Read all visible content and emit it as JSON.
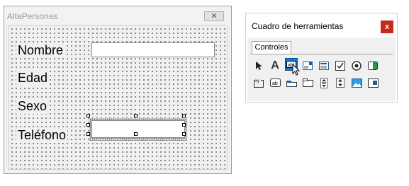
{
  "form": {
    "title": "AltaPersonas",
    "close_glyph": "✕",
    "labels": {
      "nombre": "Nombre",
      "edad": "Edad",
      "sexo": "Sexo",
      "telefono": "Teléfono"
    }
  },
  "toolbox": {
    "title": "Cuadro de herramientas",
    "close_glyph": "x",
    "tab": "Controles",
    "tools_row1": [
      {
        "icon": "select-objects-icon",
        "glyph": "➚"
      },
      {
        "icon": "label-icon",
        "glyph": "A"
      },
      {
        "icon": "textbox-icon",
        "glyph": "ab|"
      },
      {
        "icon": "combobox-icon",
        "glyph": ""
      },
      {
        "icon": "listbox-icon",
        "glyph": ""
      },
      {
        "icon": "checkbox-icon",
        "glyph": "✓"
      },
      {
        "icon": "optionbutton-icon",
        "glyph": "◉"
      },
      {
        "icon": "togglebutton-icon",
        "glyph": ""
      }
    ],
    "tools_row2": [
      {
        "icon": "frame-icon",
        "glyph": "xy"
      },
      {
        "icon": "commandbutton-icon",
        "glyph": "ab"
      },
      {
        "icon": "tabstrip-icon",
        "glyph": ""
      },
      {
        "icon": "multipage-icon",
        "glyph": ""
      },
      {
        "icon": "scrollbar-icon",
        "glyph": "▴▾"
      },
      {
        "icon": "spinbutton-icon",
        "glyph": "⇕"
      },
      {
        "icon": "image-icon",
        "glyph": ""
      },
      {
        "icon": "refedit-icon",
        "glyph": ""
      }
    ],
    "accent": "#1874cf"
  }
}
